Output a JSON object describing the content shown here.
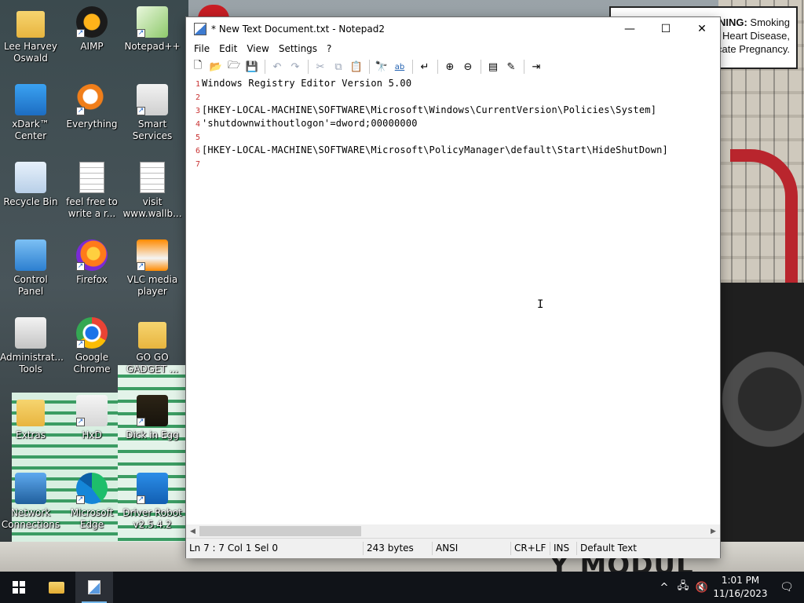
{
  "desktop": {
    "icons": [
      {
        "id": "lee-harvey-oswald",
        "label": "Lee Harvey Oswald",
        "icon": "folder-icon",
        "shortcut": false
      },
      {
        "id": "aimp",
        "label": "AIMP",
        "icon": "aimp-icon",
        "shortcut": true
      },
      {
        "id": "notepadpp",
        "label": "Notepad++",
        "icon": "notepadpp-icon",
        "shortcut": true
      },
      {
        "id": "xdark-center",
        "label": "xDark™ Center",
        "icon": "laptop-icon",
        "shortcut": false
      },
      {
        "id": "everything",
        "label": "Everything",
        "icon": "magnifier-icon",
        "shortcut": true
      },
      {
        "id": "smart-services",
        "label": "Smart Services",
        "icon": "smart-services-icon",
        "shortcut": true
      },
      {
        "id": "recycle-bin",
        "label": "Recycle Bin",
        "icon": "recycle-bin-icon",
        "shortcut": false
      },
      {
        "id": "feel-free",
        "label": "feel free to write a r...",
        "icon": "text-file-icon",
        "shortcut": false
      },
      {
        "id": "visit-wallb",
        "label": "visit www.wallb...",
        "icon": "text-file-icon",
        "shortcut": false
      },
      {
        "id": "control-panel",
        "label": "Control Panel",
        "icon": "control-panel-icon",
        "shortcut": false
      },
      {
        "id": "firefox",
        "label": "Firefox",
        "icon": "firefox-icon",
        "shortcut": true
      },
      {
        "id": "vlc",
        "label": "VLC media player",
        "icon": "vlc-cone-icon",
        "shortcut": true
      },
      {
        "id": "admin-tools",
        "label": "Administrat... Tools",
        "icon": "admin-tools-icon",
        "shortcut": false
      },
      {
        "id": "google-chrome",
        "label": "Google Chrome",
        "icon": "chrome-icon",
        "shortcut": true
      },
      {
        "id": "go-go-gadget",
        "label": "GO GO GADGET ...",
        "icon": "folder-icon",
        "shortcut": false
      },
      {
        "id": "extras",
        "label": "Extras",
        "icon": "folder-icon",
        "shortcut": false
      },
      {
        "id": "hxd",
        "label": "HxD",
        "icon": "hxd-icon",
        "shortcut": true
      },
      {
        "id": "dick-in-egg",
        "label": "Dick in Egg",
        "icon": "de-app-icon",
        "shortcut": true
      },
      {
        "id": "network-connections",
        "label": "Network Connections",
        "icon": "network-icon",
        "shortcut": false
      },
      {
        "id": "microsoft-edge",
        "label": "Microsoft Edge",
        "icon": "edge-icon",
        "shortcut": true
      },
      {
        "id": "driver-robot",
        "label": "Driver Robot v2.5.4.2",
        "icon": "robot-icon",
        "shortcut": true
      }
    ],
    "warning_sign": {
      "line1_bold": "ARNING:",
      "line1": " Smoking",
      "line2": "Heart Disease,",
      "line3": "plicate Pregnancy."
    },
    "wallpaper_text": "Y MODUL"
  },
  "window": {
    "title": "* New Text Document.txt - Notepad2",
    "controls": {
      "minimize": "—",
      "maximize": "☐",
      "close": "✕"
    },
    "menu": [
      "File",
      "Edit",
      "View",
      "Settings",
      "?"
    ],
    "toolbar": [
      {
        "name": "new-icon",
        "glyph": "🗋"
      },
      {
        "name": "open-icon",
        "glyph": "📂"
      },
      {
        "name": "browse-icon",
        "glyph": "🗁"
      },
      {
        "name": "save-icon",
        "glyph": "💾"
      },
      {
        "sep": true
      },
      {
        "name": "undo-icon",
        "glyph": "↶"
      },
      {
        "name": "redo-icon",
        "glyph": "↷"
      },
      {
        "sep": true
      },
      {
        "name": "cut-icon",
        "glyph": "✂"
      },
      {
        "name": "copy-icon",
        "glyph": "⧉"
      },
      {
        "name": "paste-icon",
        "glyph": "📋"
      },
      {
        "sep": true
      },
      {
        "name": "find-icon",
        "glyph": "🔭"
      },
      {
        "name": "replace-icon",
        "glyph": "ab"
      },
      {
        "sep": true
      },
      {
        "name": "wordwrap-icon",
        "glyph": "↵"
      },
      {
        "sep": true
      },
      {
        "name": "zoom-in-icon",
        "glyph": "⊕"
      },
      {
        "name": "zoom-out-icon",
        "glyph": "⊖"
      },
      {
        "sep": true
      },
      {
        "name": "scheme-icon",
        "glyph": "▤"
      },
      {
        "name": "customize-icon",
        "glyph": "✎"
      },
      {
        "sep": true
      },
      {
        "name": "exit-icon",
        "glyph": "⇥"
      }
    ],
    "lines": [
      {
        "n": "1",
        "text": "Windows Registry Editor Version 5.00"
      },
      {
        "n": "2",
        "text": ""
      },
      {
        "n": "3",
        "text": "[HKEY-LOCAL-MACHINE\\SOFTWARE\\Microsoft\\Windows\\CurrentVersion\\Policies\\System]"
      },
      {
        "n": "4",
        "text": "'shutdownwithoutlogon'=dword;00000000"
      },
      {
        "n": "5",
        "text": ""
      },
      {
        "n": "6",
        "text": "[HKEY-LOCAL-MACHINE\\SOFTWARE\\Microsoft\\PolicyManager\\default\\Start\\HideShutDown]"
      },
      {
        "n": "7",
        "text": ""
      }
    ],
    "scroll_left": "◀",
    "scroll_right": "▶",
    "status": {
      "position": "Ln 7 : 7   Col 1   Sel 0",
      "size": "243 bytes",
      "encoding": "ANSI",
      "eol": "CR+LF",
      "mode": "INS",
      "scheme": "Default Text"
    }
  },
  "taskbar": {
    "clock_time": "1:01 PM",
    "clock_date": "11/16/2023",
    "tray": {
      "chevron": "^",
      "network": "🖧",
      "volume": "🔇",
      "notification": "🗨"
    }
  },
  "colors": {
    "line_numbers": "#c83232",
    "taskbar": "#101318",
    "accent": "#76b9ed"
  }
}
